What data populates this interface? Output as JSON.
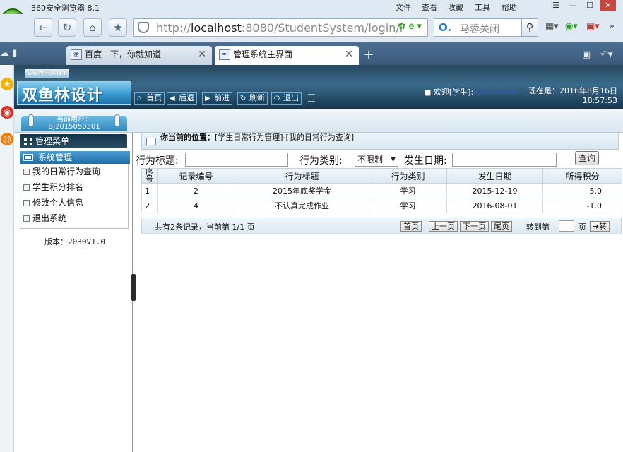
{
  "browser": {
    "title": "360安全浏览器 8.1",
    "menu": [
      "文件",
      "查看",
      "收藏",
      "工具",
      "帮助"
    ],
    "url_prefix": "http://",
    "url_host": "localhost",
    "url_rest": ":8080/StudentSystem/login/l",
    "search_placeholder": "马蓉关闭",
    "tabs": [
      {
        "label": "百度一下，你就知道",
        "active": false
      },
      {
        "label": "管理系统主界面",
        "active": true
      }
    ]
  },
  "app": {
    "company": "COMPANY",
    "logo": "双鱼林设计",
    "toolbar": [
      "首页",
      "后退",
      "前进",
      "刷新",
      "退出"
    ],
    "welcome_label": "欢迎[学生]:",
    "welcome_user": "BJ2015050301",
    "now_label": "现在是：2016年8月16日",
    "now_time": "18:57:53",
    "current_user_label": "当前用户：",
    "current_user_id": "BJ2015050301",
    "menu_title": "管理菜单",
    "system_section": "系统管理",
    "menu_items": [
      "我的日常行为查询",
      "学生积分排名",
      "修改个人信息",
      "退出系统"
    ],
    "version": "版本：2030V1.0"
  },
  "content": {
    "crumb_label": "你当前的位置：",
    "crumb_value": "[学生日常行为管理]-[我的日常行为查询]",
    "filter": {
      "title_label": "行为标题:",
      "type_label": "行为类别:",
      "type_value": "不限制",
      "date_label": "发生日期:",
      "query_btn": "查询"
    },
    "table": {
      "headers": [
        "序号",
        "记录编号",
        "行为标题",
        "行为类别",
        "发生日期",
        "所得积分"
      ],
      "rows": [
        [
          "1",
          "2",
          "2015年底奖学金",
          "学习",
          "2015-12-19",
          "5.0"
        ],
        [
          "2",
          "4",
          "不认真完成作业",
          "学习",
          "2016-08-01",
          "-1.0"
        ]
      ]
    },
    "pager": {
      "info": "共有2条记录，当前第 1/1 页",
      "first": "首页",
      "prev": "上一页",
      "next": "下一页",
      "last": "尾页",
      "goto_label": "转到第",
      "page_unit": "页",
      "go": "转"
    }
  },
  "colors": {
    "header_dark": "#27475e",
    "menu_blue": "#1f6ea8",
    "tabbar": "#4c6f92"
  }
}
